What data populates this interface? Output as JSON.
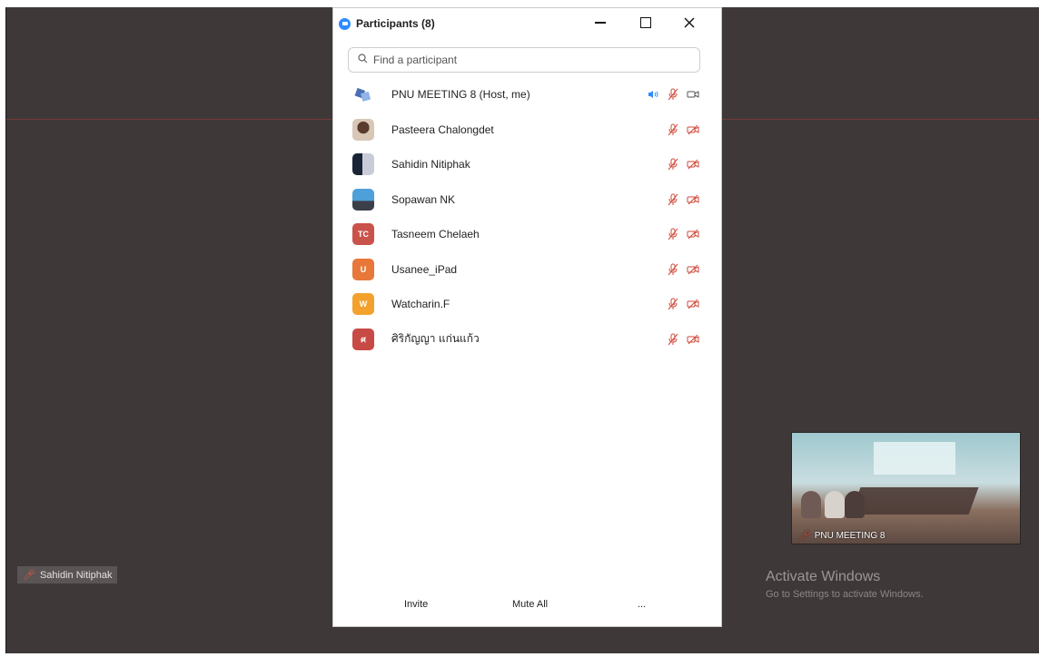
{
  "panel": {
    "title": "Participants (8)",
    "search_placeholder": "Find a participant",
    "participants": [
      {
        "name": "PNU MEETING 8 (Host, me)",
        "avatar": "host-icon",
        "speaking": true,
        "muted": true,
        "video_off": false
      },
      {
        "name": "Pasteera Chalongdet",
        "avatar": "photo",
        "muted": true,
        "video_off": true
      },
      {
        "name": "Sahidin Nitiphak",
        "avatar": "photo",
        "muted": true,
        "video_off": true
      },
      {
        "name": "Sopawan NK",
        "avatar": "photo",
        "muted": true,
        "video_off": true
      },
      {
        "name": "Tasneem Chelaeh",
        "avatar_initials": "TC",
        "avatar_color": "#c9524a",
        "muted": true,
        "video_off": true
      },
      {
        "name": "Usanee_iPad",
        "avatar_initials": "U",
        "avatar_color": "#e8783a",
        "muted": true,
        "video_off": true
      },
      {
        "name": "Watcharin.F",
        "avatar_initials": "W",
        "avatar_color": "#f2a22c",
        "muted": true,
        "video_off": true
      },
      {
        "name": "ศิริกัญญา แก่นแก้ว",
        "avatar_initials": "ศ",
        "avatar_color": "#c84a45",
        "muted": true,
        "video_off": true
      }
    ],
    "footer": {
      "invite": "Invite",
      "mute_all": "Mute All",
      "more": "..."
    }
  },
  "meeting": {
    "active_speaker_name": "Sahidin Nitiphak",
    "self_video_label": "PNU MEETING 8"
  },
  "watermark": {
    "title": "Activate Windows",
    "subtitle": "Go to Settings to activate Windows."
  }
}
